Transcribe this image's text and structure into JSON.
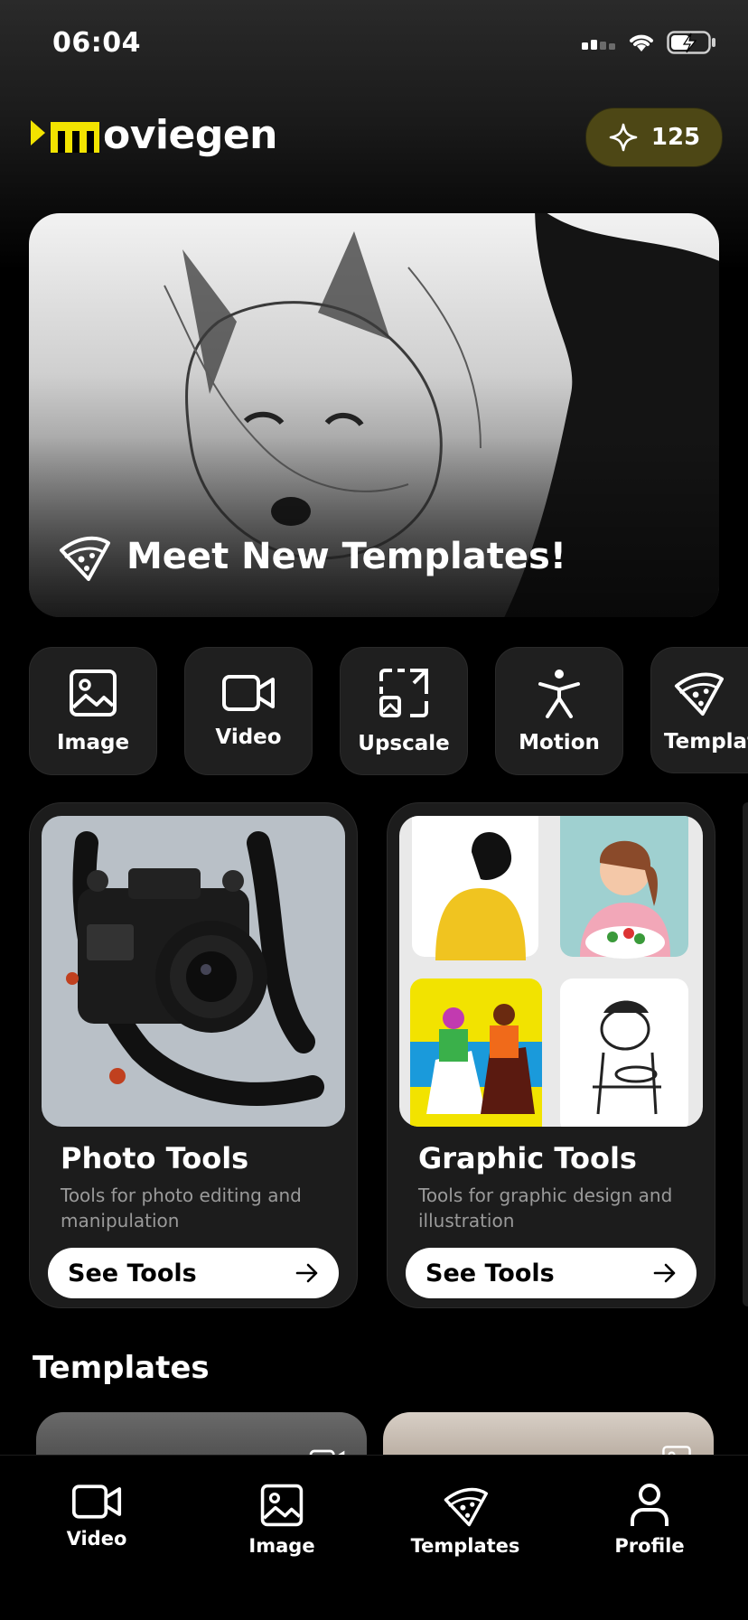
{
  "status_bar": {
    "time": "06:04"
  },
  "header": {
    "logo_text": "oviegen",
    "credits": "125"
  },
  "hero": {
    "title": "Meet New Templates!"
  },
  "quick_tools": [
    {
      "label": "Image",
      "icon": "image-icon"
    },
    {
      "label": "Video",
      "icon": "video-icon"
    },
    {
      "label": "Upscale",
      "icon": "upscale-icon"
    },
    {
      "label": "Motion",
      "icon": "motion-icon"
    },
    {
      "label": "Templat",
      "icon": "pizza-slice-icon"
    }
  ],
  "tool_cards": [
    {
      "title": "Photo Tools",
      "description": "Tools for photo editing and manipulation",
      "button_label": "See Tools"
    },
    {
      "title": "Graphic Tools",
      "description": "Tools for graphic design and illustration",
      "button_label": "See Tools"
    }
  ],
  "templates_section": {
    "title": "Templates"
  },
  "tab_bar": [
    {
      "label": "Video",
      "icon": "video-icon"
    },
    {
      "label": "Image",
      "icon": "image-icon"
    },
    {
      "label": "Templates",
      "icon": "pizza-slice-icon"
    },
    {
      "label": "Profile",
      "icon": "profile-icon"
    }
  ],
  "colors": {
    "accent_yellow": "#f2e300",
    "credits_bg": "#4d4715",
    "card_bg": "#1c1c1c"
  }
}
